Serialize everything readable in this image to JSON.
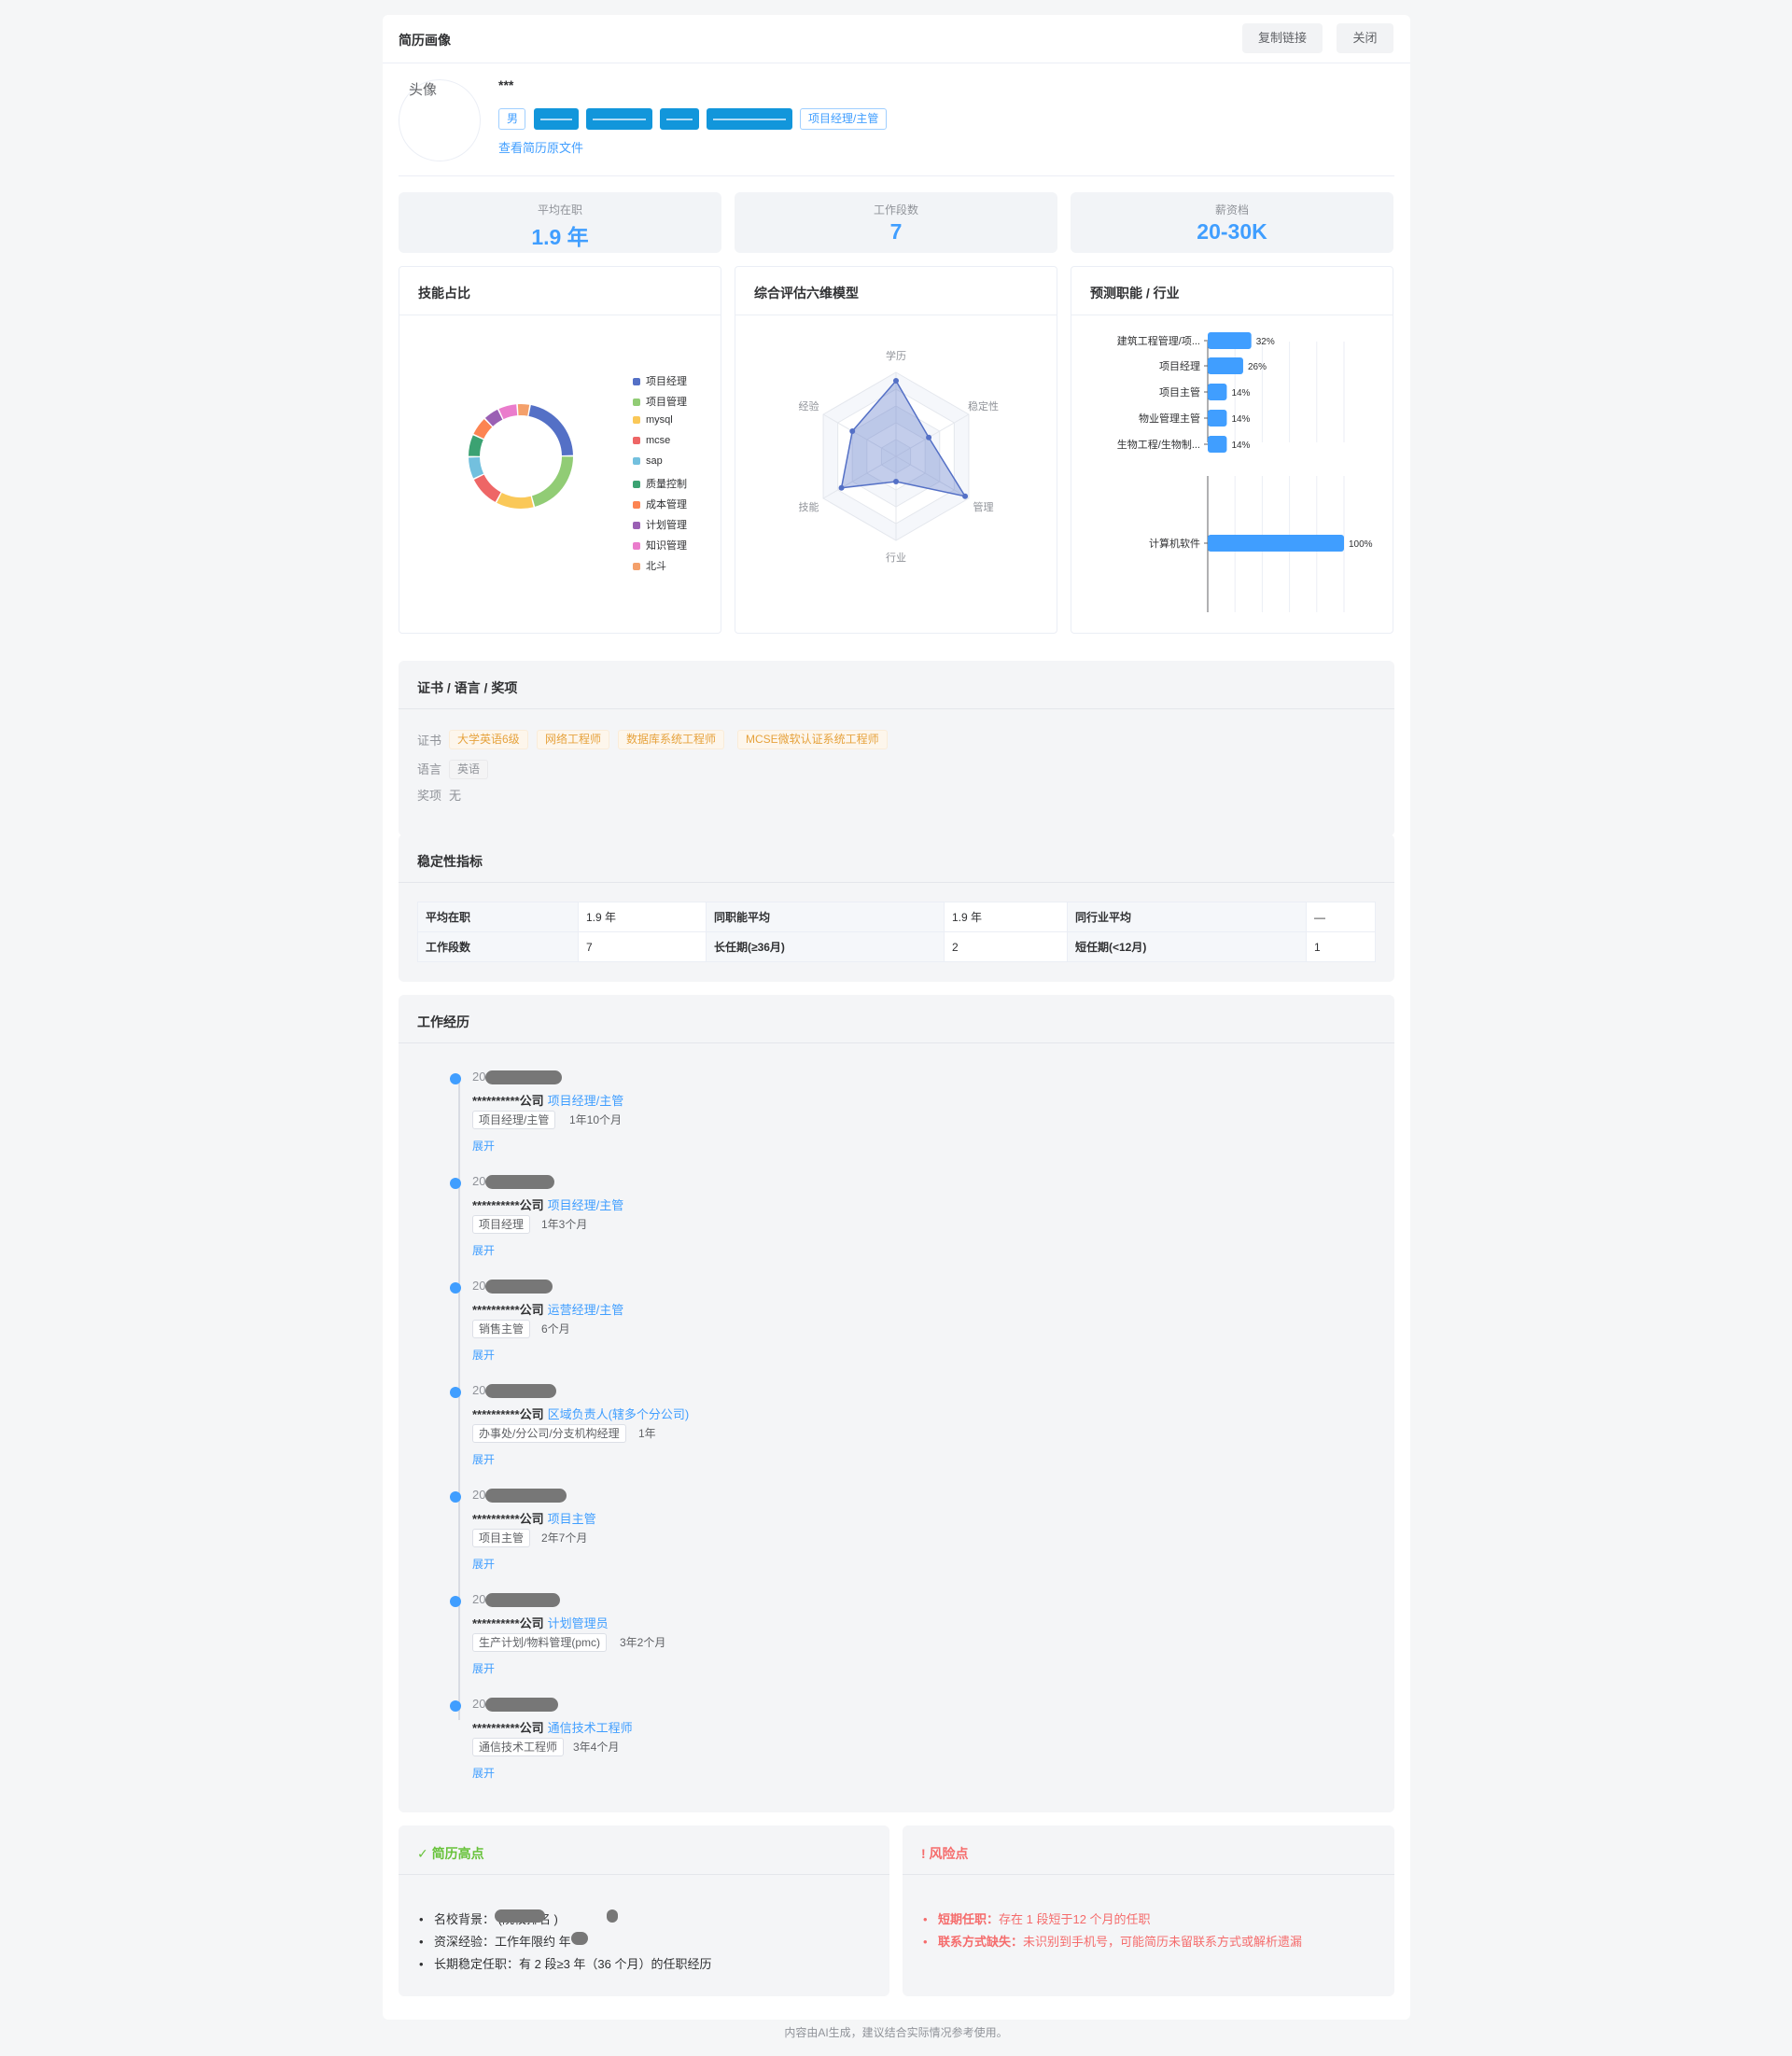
{
  "header": {
    "title": "简历画像",
    "copy_link": "复制链接",
    "close": "关闭"
  },
  "profile": {
    "avatar_alt": "头像",
    "name": "***",
    "tags": [
      "男",
      "",
      "",
      "",
      "",
      "项目经理/主管"
    ],
    "view_file_link": "查看简历原文件"
  },
  "stats": [
    {
      "label": "平均在职",
      "value": "1.9 年"
    },
    {
      "label": "工作段数",
      "value": "7"
    },
    {
      "label": "薪资档",
      "value": "20-30K"
    }
  ],
  "panels": {
    "skills": "技能占比",
    "radar": "综合评估六维模型",
    "predict": "预测职能 / 行业"
  },
  "skill_legend": [
    "项目经理",
    "项目管理",
    "mysql",
    "mcse",
    "sap",
    "质量控制",
    "成本管理",
    "计划管理",
    "知识管理",
    "北斗"
  ],
  "colors": {
    "accent": "#409eff",
    "success": "#67c23a",
    "danger": "#f56c6c",
    "warning": "#e6a23c"
  },
  "chart_data": [
    {
      "type": "pie",
      "labels": [
        "项目经理",
        "项目管理",
        "mysql",
        "mcse",
        "sap",
        "质量控制",
        "成本管理",
        "计划管理",
        "知识管理",
        "北斗"
      ],
      "values": [
        22,
        21,
        12,
        10,
        7,
        7,
        6,
        5,
        6,
        4
      ],
      "colors": [
        "#5470c6",
        "#91cc75",
        "#fac858",
        "#ee6666",
        "#73c0de",
        "#3ba272",
        "#fc8452",
        "#9a60b4",
        "#ea7ccc",
        "#f4a06b"
      ]
    },
    {
      "type": "radar",
      "axes": [
        "学历",
        "稳定性",
        "管理",
        "行业",
        "技能",
        "经验"
      ],
      "values": [
        90,
        45,
        95,
        30,
        75,
        60
      ],
      "max": 100
    },
    {
      "type": "bar",
      "orientation": "horizontal",
      "categories": [
        "建筑工程管理/项...",
        "项目经理",
        "项目主管",
        "物业管理主管",
        "生物工程/生物制..."
      ],
      "values": [
        32,
        26,
        14,
        14,
        14
      ],
      "labels": [
        "32%",
        "26%",
        "14%",
        "14%",
        "14%"
      ]
    },
    {
      "type": "bar",
      "orientation": "horizontal",
      "categories": [
        "计算机软件"
      ],
      "values": [
        100
      ],
      "labels": [
        "100%"
      ]
    }
  ],
  "certs": {
    "title": "证书 / 语言 / 奖项",
    "cert_label": "证书",
    "cert_items": [
      "大学英语6级",
      "网络工程师",
      "数据库系统工程师",
      "MCSE微软认证系统工程师"
    ],
    "lang_label": "语言",
    "lang_items": [
      "英语"
    ],
    "award_label": "奖项",
    "award_value": "无"
  },
  "stability": {
    "title": "稳定性指标",
    "rows": [
      [
        "平均在职",
        "1.9 年",
        "同职能平均",
        "1.9 年",
        "同行业平均",
        "—"
      ],
      [
        "工作段数",
        "7",
        "长任期(≥36月)",
        "2",
        "短任期(<12月)",
        "1"
      ]
    ]
  },
  "work": {
    "title": "工作经历",
    "expand": "展开",
    "items": [
      {
        "date": "20",
        "company": "**********公司",
        "role": "项目经理/主管",
        "tag": "项目经理/主管",
        "duration": "1年10个月"
      },
      {
        "date": "20",
        "company": "**********公司",
        "role": "项目经理/主管",
        "tag": "项目经理",
        "duration": "1年3个月"
      },
      {
        "date": "20",
        "company": "**********公司",
        "role": "运营经理/主管",
        "tag": "销售主管",
        "duration": "6个月"
      },
      {
        "date": "20",
        "company": "**********公司",
        "role": "区域负责人(辖多个分公司)",
        "tag": "办事处/分公司/分支机构经理",
        "duration": "1年"
      },
      {
        "date": "20",
        "company": "**********公司",
        "role": "项目主管",
        "tag": "项目主管",
        "duration": "2年7个月"
      },
      {
        "date": "20",
        "company": "**********公司",
        "role": "计划管理员",
        "tag": "生产计划/物料管理(pmc)",
        "duration": "3年2个月"
      },
      {
        "date": "20",
        "company": "**********公司",
        "role": "通信技术工程师",
        "tag": "通信技术工程师",
        "duration": "3年4个月"
      }
    ]
  },
  "highlights": {
    "title": "✓ 简历高点",
    "items": [
      "名校背景： (院校排名 )",
      "资深经验：工作年限约 年",
      "长期稳定任职：有 2 段≥3 年（36 个月）的任职经历"
    ]
  },
  "risks": {
    "title": "! 风险点",
    "items": [
      {
        "k": "短期任职：",
        "v": "存在 1 段短于12 个月的任职"
      },
      {
        "k": "联系方式缺失：",
        "v": "未识别到手机号，可能简历未留联系方式或解析遗漏"
      }
    ]
  },
  "footer": "内容由AI生成，建议结合实际情况参考使用。"
}
